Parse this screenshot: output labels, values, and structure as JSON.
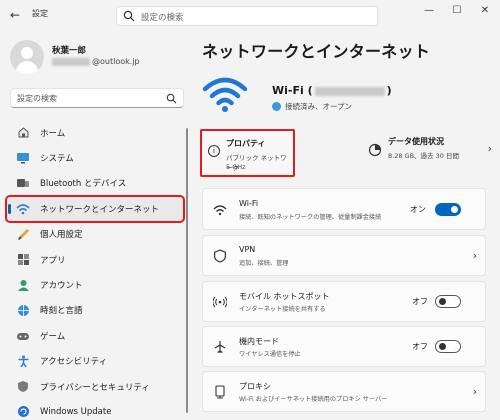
{
  "titlebar": {
    "back_icon": "back-arrow-icon",
    "title": "設定",
    "search_placeholder": "設定の検索",
    "minimize": "—",
    "maximize": "☐",
    "close": "✕"
  },
  "user": {
    "name": "秋葉一郎",
    "email_suffix": "@outlook.jp"
  },
  "sidebar": {
    "search_placeholder": "設定の検索",
    "items": [
      {
        "label": "ホーム",
        "icon": "home-icon"
      },
      {
        "label": "システム",
        "icon": "system-icon"
      },
      {
        "label": "Bluetooth とデバイス",
        "icon": "bluetooth-icon"
      },
      {
        "label": "ネットワークとインターネット",
        "icon": "wifi-icon",
        "active": true
      },
      {
        "label": "個人用設定",
        "icon": "brush-icon"
      },
      {
        "label": "アプリ",
        "icon": "apps-icon"
      },
      {
        "label": "アカウント",
        "icon": "account-icon"
      },
      {
        "label": "時刻と言語",
        "icon": "globe-icon"
      },
      {
        "label": "ゲーム",
        "icon": "game-icon"
      },
      {
        "label": "アクセシビリティ",
        "icon": "accessibility-icon"
      },
      {
        "label": "プライバシーとセキュリティ",
        "icon": "shield-icon"
      },
      {
        "label": "Windows Update",
        "icon": "update-icon"
      }
    ]
  },
  "main": {
    "title": "ネットワークとインターネット",
    "wifi": {
      "name_prefix": "Wi-Fi (",
      "name_suffix": ")",
      "status": "接続済み、オープン"
    },
    "properties": {
      "title": "プロパティ",
      "line1": "パブリック ネットワーク",
      "line2": "5 GHz"
    },
    "usage": {
      "title": "データ使用状況",
      "detail": "8.28 GB、過去 30 日間"
    },
    "rows": [
      {
        "title": "Wi-Fi",
        "desc": "接続、既知のネットワークの管理、従量制課金接続",
        "icon": "wifi-icon",
        "state": "オン",
        "toggle": "on"
      },
      {
        "title": "VPN",
        "desc": "追加、接続、管理",
        "icon": "vpn-shield-icon"
      },
      {
        "title": "モバイル ホットスポット",
        "desc": "インターネット接続を共有する",
        "icon": "hotspot-icon",
        "state": "オフ",
        "toggle": "off"
      },
      {
        "title": "機内モード",
        "desc": "ワイヤレス通信を停止",
        "icon": "airplane-icon",
        "state": "オフ",
        "toggle": "off"
      },
      {
        "title": "プロキシ",
        "desc": "Wi-Fi およびイーサネット接続用のプロキシ サーバー",
        "icon": "proxy-icon"
      }
    ]
  },
  "colors": {
    "accent": "#0067c0",
    "highlight": "#e21b1b"
  }
}
